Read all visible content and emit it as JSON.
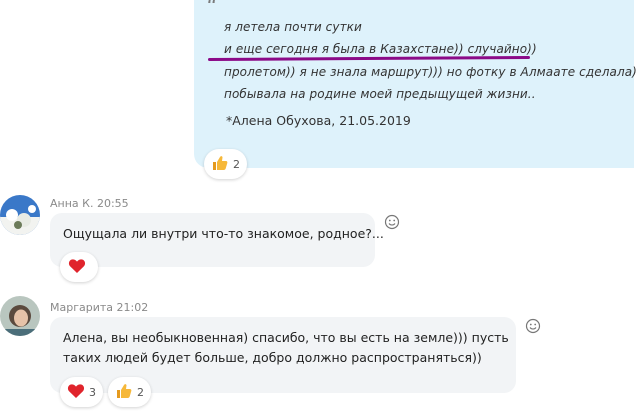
{
  "quoted_message": {
    "lines": [
      "я летела почти сутки",
      "и еще сегодня я была в Казахстане)) случайно))",
      "пролетом)) я не знала маршрут))) но фотку в Алмаате сделала)",
      "побывала на родине моей предыщущей жизни.."
    ],
    "author": "*Алена Обухова, 21.05.2019",
    "reactions": [
      {
        "icon": "thumbs-up-icon",
        "count": "2"
      }
    ],
    "underline_color": "#8b0a88",
    "bubble_color": "#def2fb"
  },
  "messages": [
    {
      "sender": "Анна К. 20:55",
      "text": "Ощущала ли внутри что-то знакомое, родное?...",
      "reactions": [
        {
          "icon": "heart-icon",
          "count": ""
        }
      ]
    },
    {
      "sender": "Маргарита 21:02",
      "text_lines": [
        "Алена, вы необыкновенная) спасибо, что вы есть на земле))) пусть",
        "таких людей будет больше, добро должно распространяться))"
      ],
      "reactions": [
        {
          "icon": "heart-icon",
          "count": "3"
        },
        {
          "icon": "thumbs-up-icon",
          "count": "2"
        }
      ]
    }
  ],
  "colors": {
    "heart": "#e0242c",
    "thumbs": "#f6b83a",
    "incoming_bubble": "#f2f4f6"
  }
}
